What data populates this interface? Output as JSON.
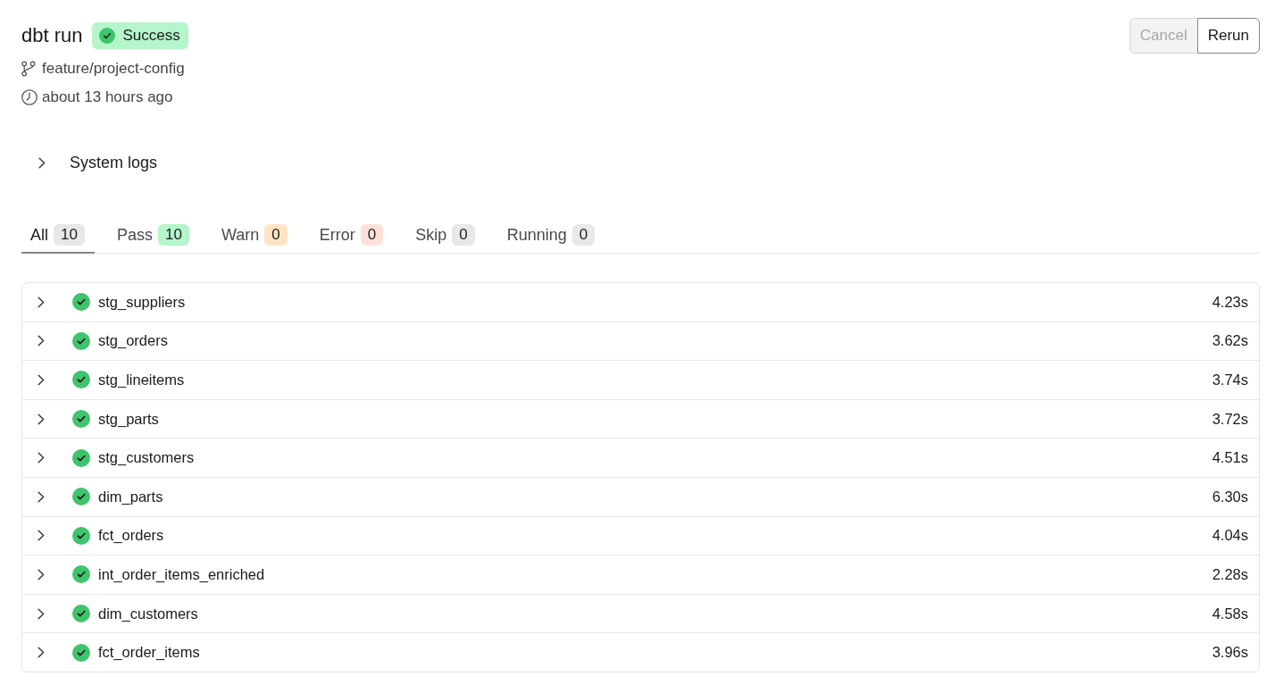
{
  "run": {
    "title": "dbt run",
    "status": {
      "label": "Success",
      "kind": "success"
    },
    "branch": "feature/project-config",
    "time": "about 13 hours ago"
  },
  "actions": [
    {
      "label": "Cancel",
      "disabled": true
    },
    {
      "label": "Rerun",
      "disabled": false
    }
  ],
  "system_logs": {
    "label": "System logs",
    "expanded": false
  },
  "tabs": [
    {
      "label": "All",
      "count": "10",
      "color": "#e8e8e8",
      "selected": true
    },
    {
      "label": "Pass",
      "count": "10",
      "color": "#b4f5c9",
      "selected": false
    },
    {
      "label": "Warn",
      "count": "0",
      "color": "#ffe4c4",
      "selected": false
    },
    {
      "label": "Error",
      "count": "0",
      "color": "#fde1d9",
      "selected": false
    },
    {
      "label": "Skip",
      "count": "0",
      "color": "#e8e8e8",
      "selected": false
    },
    {
      "label": "Running",
      "count": "0",
      "color": "#e8e8e8",
      "selected": false
    }
  ],
  "models": [
    {
      "name": "stg_suppliers",
      "kind": "success",
      "expanded": false,
      "duration": "4.23s"
    },
    {
      "name": "stg_orders",
      "kind": "success",
      "expanded": false,
      "duration": "3.62s"
    },
    {
      "name": "stg_lineitems",
      "kind": "success",
      "expanded": false,
      "duration": "3.74s"
    },
    {
      "name": "stg_parts",
      "kind": "success",
      "expanded": false,
      "duration": "3.72s"
    },
    {
      "name": "stg_customers",
      "kind": "success",
      "expanded": false,
      "duration": "4.51s"
    },
    {
      "name": "dim_parts",
      "kind": "success",
      "expanded": false,
      "duration": "6.30s"
    },
    {
      "name": "fct_orders",
      "kind": "success",
      "expanded": false,
      "duration": "4.04s"
    },
    {
      "name": "int_order_items_enriched",
      "kind": "success",
      "expanded": false,
      "duration": "2.28s"
    },
    {
      "name": "dim_customers",
      "kind": "success",
      "expanded": false,
      "duration": "4.58s"
    },
    {
      "name": "fct_order_items",
      "kind": "success",
      "expanded": false,
      "duration": "3.96s"
    }
  ]
}
